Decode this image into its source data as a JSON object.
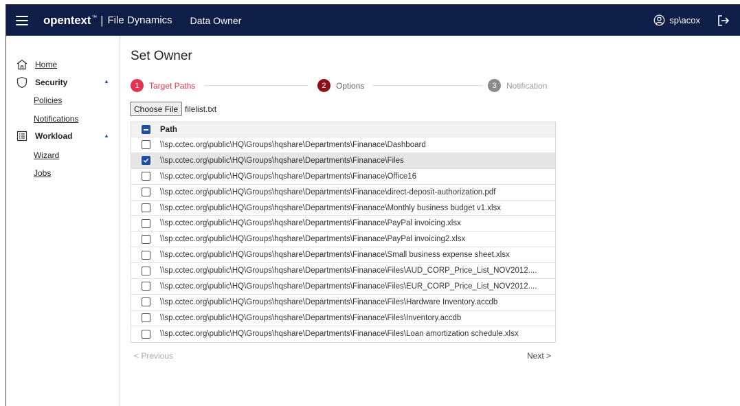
{
  "header": {
    "brand": "opentext",
    "brand_tm": "™",
    "separator": "|",
    "app_name": "File Dynamics",
    "module": "Data Owner",
    "user": "sp\\acox"
  },
  "sidebar": {
    "home": "Home",
    "security": "Security",
    "policies": "Policies",
    "notifications": "Notifications",
    "workload": "Workload",
    "wizard": "Wizard",
    "jobs": "Jobs"
  },
  "page": {
    "title": "Set Owner"
  },
  "stepper": {
    "steps": [
      {
        "num": "1",
        "label": "Target Paths"
      },
      {
        "num": "2",
        "label": "Options"
      },
      {
        "num": "3",
        "label": "Notification"
      }
    ]
  },
  "file": {
    "button": "Choose File",
    "name": "filelist.txt"
  },
  "table": {
    "header": "Path",
    "rows": [
      "\\\\sp.cctec.org\\public\\HQ\\Groups\\hqshare\\Departments\\Finanace\\Dashboard",
      "\\\\sp.cctec.org\\public\\HQ\\Groups\\hqshare\\Departments\\Finanace\\Files",
      "\\\\sp.cctec.org\\public\\HQ\\Groups\\hqshare\\Departments\\Finanace\\Office16",
      "\\\\sp.cctec.org\\public\\HQ\\Groups\\hqshare\\Departments\\Finanace\\direct-deposit-authorization.pdf",
      "\\\\sp.cctec.org\\public\\HQ\\Groups\\hqshare\\Departments\\Finanace\\Monthly business budget v1.xlsx",
      "\\\\sp.cctec.org\\public\\HQ\\Groups\\hqshare\\Departments\\Finanace\\PayPal invoicing.xlsx",
      "\\\\sp.cctec.org\\public\\HQ\\Groups\\hqshare\\Departments\\Finanace\\PayPal invoicing2.xlsx",
      "\\\\sp.cctec.org\\public\\HQ\\Groups\\hqshare\\Departments\\Finanace\\Small business expense sheet.xlsx",
      "\\\\sp.cctec.org\\public\\HQ\\Groups\\hqshare\\Departments\\Finanace\\Files\\AUD_CORP_Price_List_NOV2012....",
      "\\\\sp.cctec.org\\public\\HQ\\Groups\\hqshare\\Departments\\Finanace\\Files\\EUR_CORP_Price_List_NOV2012....",
      "\\\\sp.cctec.org\\public\\HQ\\Groups\\hqshare\\Departments\\Finanace\\Files\\Hardware Inventory.accdb",
      "\\\\sp.cctec.org\\public\\HQ\\Groups\\hqshare\\Departments\\Finanace\\Files\\Inventory.accdb",
      "\\\\sp.cctec.org\\public\\HQ\\Groups\\hqshare\\Departments\\Finanace\\Files\\Loan amortization schedule.xlsx"
    ],
    "checked": [
      false,
      true,
      false,
      false,
      false,
      false,
      false,
      false,
      false,
      false,
      false,
      false,
      false
    ]
  },
  "pager": {
    "previous": "< Previous",
    "next": "Next >"
  },
  "colors": {
    "topbar": "#0f1e48",
    "step_active": "#e4334f",
    "step_done": "#8b1018",
    "step_inactive": "#8a8a8a",
    "accent": "#1f4fa5"
  }
}
